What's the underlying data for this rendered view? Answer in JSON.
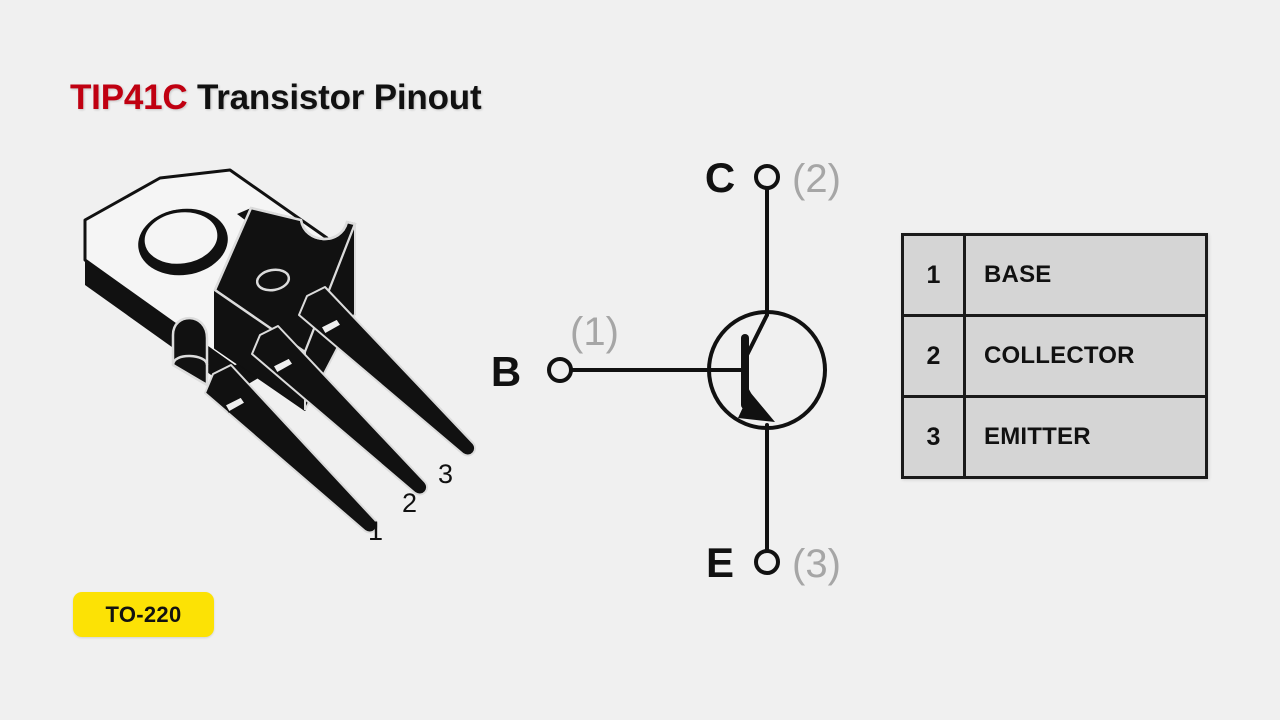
{
  "page": {
    "background_color": "#f0f0f0",
    "title_part_red": "TIP41C",
    "title_part_dark": " Transistor Pinout",
    "accent_red": "#C00011",
    "badge_yellow": "#FCE205",
    "table_fill": "#d5d5d5",
    "line_color": "#111111",
    "muted_gray": "#9a9a9a"
  },
  "badge": {
    "label": "TO-220"
  },
  "package": {
    "name": "TO-220 package 3D drawing",
    "lead_labels": [
      "1",
      "2",
      "3"
    ]
  },
  "schematic": {
    "type": "NPN bipolar junction transistor",
    "terminals": [
      {
        "letter": "B",
        "pin_ref": "(1)",
        "name": "base"
      },
      {
        "letter": "C",
        "pin_ref": "(2)",
        "name": "collector"
      },
      {
        "letter": "E",
        "pin_ref": "(3)",
        "name": "emitter"
      }
    ]
  },
  "pin_table": {
    "rows": [
      {
        "number": "1",
        "function": "BASE"
      },
      {
        "number": "2",
        "function": "COLLECTOR"
      },
      {
        "number": "3",
        "function": "EMITTER"
      }
    ]
  }
}
